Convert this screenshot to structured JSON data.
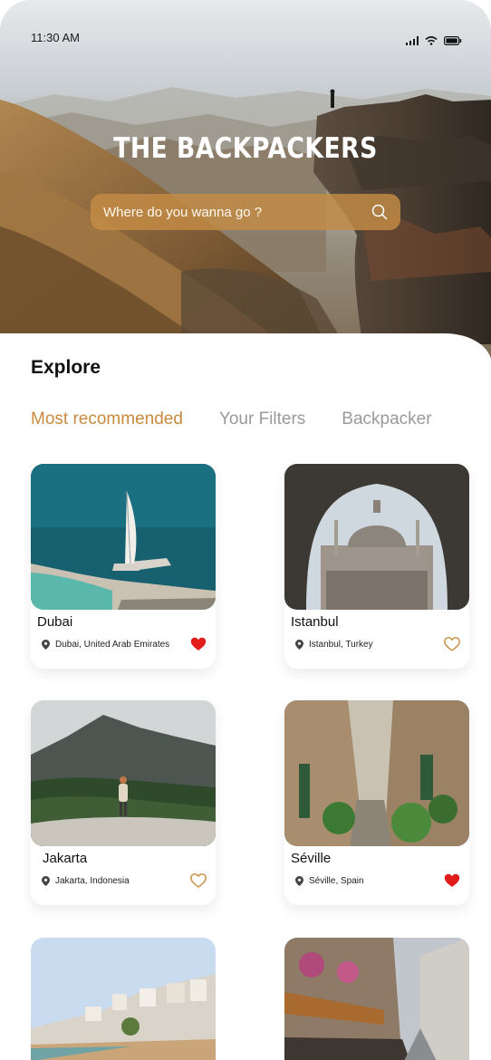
{
  "status_bar": {
    "time": "11:30 AM"
  },
  "header": {
    "title": "THE BACKPACKERS"
  },
  "search": {
    "placeholder": "Where do you wanna go ?"
  },
  "explore": {
    "title": "Explore",
    "tabs": [
      {
        "label": "Most recommended",
        "active": true
      },
      {
        "label": "Your Filters",
        "active": false
      },
      {
        "label": "Backpacker",
        "active": false
      }
    ]
  },
  "cards": [
    {
      "name": "Dubai",
      "location": "Dubai, United Arab Emirates",
      "favorited": true
    },
    {
      "name": "Istanbul",
      "location": "Istanbul, Turkey",
      "favorited": false
    },
    {
      "name": "Jakarta",
      "location": "Jakarta, Indonesia",
      "favorited": false
    },
    {
      "name": "Séville",
      "location": "Séville, Spain",
      "favorited": true
    }
  ],
  "partial_cards": [
    {
      "image": "coastal-village"
    },
    {
      "image": "cafe-street"
    }
  ],
  "colors": {
    "accent": "#c98a3e",
    "heart_filled": "#e21b1b",
    "heart_outline": "#c98a3e",
    "search_bg": "#c48c46"
  }
}
